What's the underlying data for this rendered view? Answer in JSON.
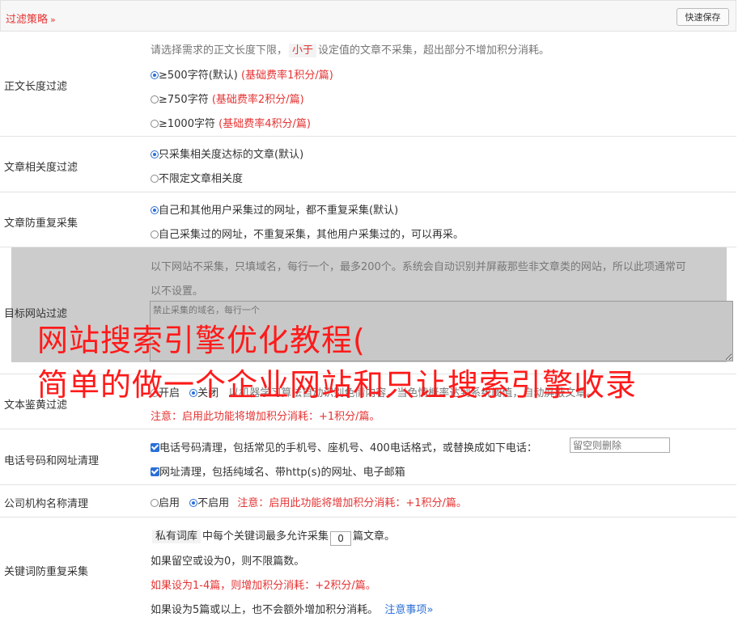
{
  "header": {
    "title": "过滤策略",
    "chevron": "»",
    "save_label": "快速保存"
  },
  "length_filter": {
    "label": "正文长度过滤",
    "desc_pre": "请选择需求的正文长度下限，",
    "desc_tag": "小于",
    "desc_post": "设定值的文章不采集，超出部分不增加积分消耗。",
    "options": [
      {
        "text": "≥500字符(默认)",
        "note": "(基础费率1积分/篇)"
      },
      {
        "text": "≥750字符",
        "note": "(基础费率2积分/篇)"
      },
      {
        "text": "≥1000字符",
        "note": "(基础费率4积分/篇)"
      }
    ]
  },
  "relevance": {
    "label": "文章相关度过滤",
    "options": [
      "只采集相关度达标的文章(默认)",
      "不限定文章相关度"
    ]
  },
  "dedup": {
    "label": "文章防重复采集",
    "options": [
      "自己和其他用户采集过的网址，都不重复采集(默认)",
      "自己采集过的网址，不重复采集，其他用户采集过的，可以再采。"
    ]
  },
  "target_site": {
    "label": "目标网站过滤",
    "desc_line1": "以下网站不采集，只填域名，每行一个，最多200个。系统会自动识别并屏蔽那些非文章类的网站，所以此项通常可",
    "desc_line2": "以不设置。",
    "placeholder": "禁止采集的域名，每行一个"
  },
  "porn": {
    "label": "文本鉴黄过滤",
    "opt_on": "开启",
    "opt_off": "关闭",
    "desc": "以机器学习算法自动识别色情内容，当色情概率达到系统阈值，自动屏蔽文章。",
    "note": "注意：启用此功能将增加积分消耗：+1积分/篇。"
  },
  "phone": {
    "label": "电话号码和网址清理",
    "phone_text": "电话号码清理，包括常见的手机号、座机号、400电话格式，或替换成如下电话：",
    "phone_placeholder": "留空则删除",
    "url_text": "网址清理，包括纯域名、带http(s)的网址、电子邮箱"
  },
  "company": {
    "label": "公司机构名称清理",
    "opt_on": "启用",
    "opt_off": "不启用",
    "note": "注意：启用此功能将增加积分消耗：+1积分/篇。"
  },
  "keyword": {
    "label": "关键词防重复采集",
    "tag": "私有词库",
    "line1_pre": "中每个关键词最多允许采集",
    "value": "0",
    "line1_post": "篇文章。",
    "line2": "如果留空或设为0，则不限篇数。",
    "line3": "如果设为1-4篇，则增加积分消耗：+2积分/篇。",
    "line4": "如果设为5篇或以上，也不会额外增加积分消耗。",
    "notice": "注意事项",
    "notice_chev": "»"
  },
  "watermark": {
    "line1": "网站搜索引擎优化教程(",
    "line2": "简单的做一个企业网站和只让搜索引擎收录"
  }
}
